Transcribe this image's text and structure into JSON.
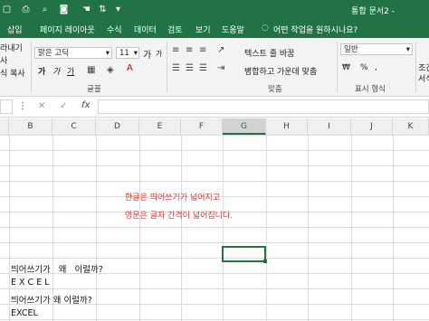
{
  "window": {
    "title": "통합 문서2 -"
  },
  "tabs": [
    "삽입",
    "페이지 레이아웃",
    "수식",
    "데이터",
    "검토",
    "보기",
    "도움말"
  ],
  "search": {
    "label": "어떤 작업을 원하시나요?"
  },
  "ribbon": {
    "clipboard": {
      "cut": "라내기",
      "copy": "사",
      "format_painter": "식 복사"
    },
    "font": {
      "name": "맑은 고딕",
      "size": "11",
      "bold": "가",
      "italic": "가",
      "underline": "가",
      "grow": "가",
      "shrink": "가",
      "group_label": "글꼴"
    },
    "alignment": {
      "wrap_text": "텍스트 줄 바꿈",
      "merge_center": "병합하고 가운데 맞춤",
      "group_label": "맞춤"
    },
    "number": {
      "format": "일반",
      "group_label": "표시 형식",
      "percent": "%",
      "comma": ",",
      "currency": "₩"
    },
    "styles": {
      "label1": "조건",
      "label2": "서식"
    }
  },
  "formula_bar": {
    "fx": "fx",
    "cancel": "✕",
    "confirm": "✓",
    "value": ""
  },
  "columns": [
    "B",
    "C",
    "D",
    "E",
    "F",
    "G",
    "H",
    "I",
    "J",
    "K"
  ],
  "cells": {
    "red_line1": "한글은 띄어쓰기가 넓어지고",
    "red_line2": "영문은 글자 간격이 넓어집니다.",
    "row1": "띄어쓰기가   왜   이럴까?",
    "row2": "E X C E L",
    "row3": "띄어쓰기가 왜 이럴까?",
    "row4": "EXCEL"
  },
  "colors": {
    "brand": "#217346",
    "annotation": "#e03030"
  }
}
